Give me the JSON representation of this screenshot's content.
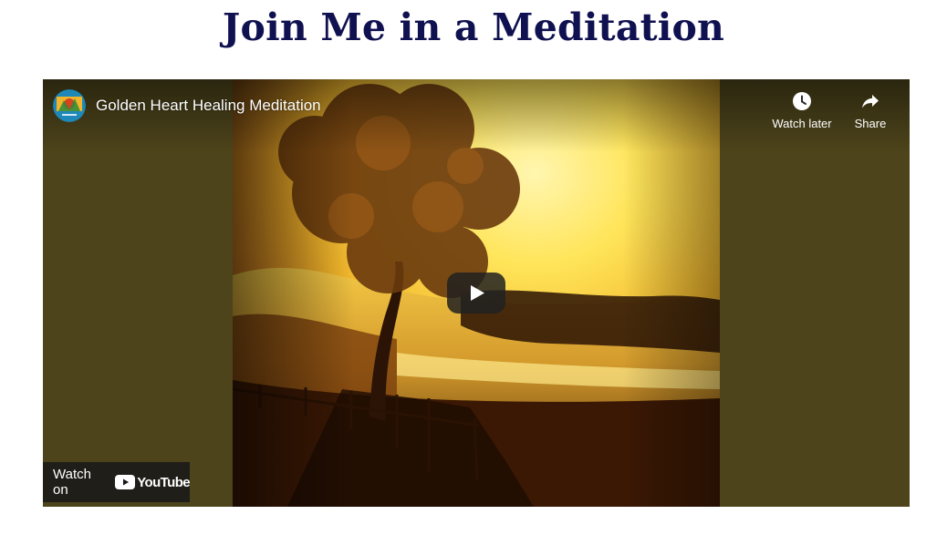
{
  "page": {
    "title": "Join Me in a Meditation"
  },
  "player": {
    "video_title": "Golden Heart Healing Meditation",
    "watch_later_label": "Watch later",
    "share_label": "Share",
    "watch_on_label": "Watch on",
    "youtube_wordmark": "YouTube",
    "play_button_label": "Play",
    "letterbox_color": "#4d441b",
    "play_button_color": "#212121"
  },
  "icons": {
    "watch_later": "clock-icon",
    "share": "share-arrow-icon",
    "play": "play-icon",
    "youtube": "youtube-logo-icon",
    "channel": "channel-avatar"
  }
}
